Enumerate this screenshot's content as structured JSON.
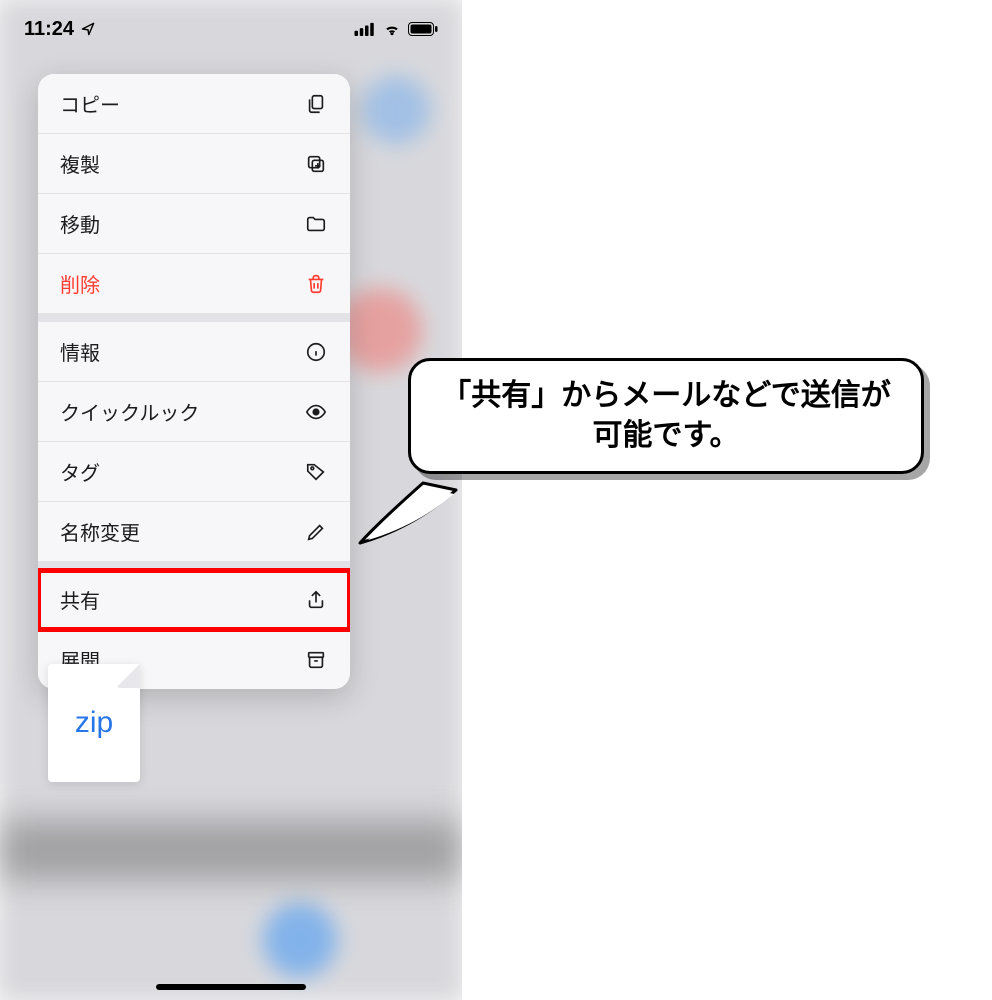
{
  "status_bar": {
    "time": "11:24"
  },
  "context_menu": {
    "sections": [
      {
        "items": [
          {
            "label": "コピー",
            "icon": "copy-icon",
            "destructive": false,
            "highlighted": false
          },
          {
            "label": "複製",
            "icon": "duplicate-icon",
            "destructive": false,
            "highlighted": false
          },
          {
            "label": "移動",
            "icon": "folder-icon",
            "destructive": false,
            "highlighted": false
          },
          {
            "label": "削除",
            "icon": "trash-icon",
            "destructive": true,
            "highlighted": false
          }
        ]
      },
      {
        "items": [
          {
            "label": "情報",
            "icon": "info-icon",
            "destructive": false,
            "highlighted": false
          },
          {
            "label": "クイックルック",
            "icon": "eye-icon",
            "destructive": false,
            "highlighted": false
          },
          {
            "label": "タグ",
            "icon": "tag-icon",
            "destructive": false,
            "highlighted": false
          },
          {
            "label": "名称変更",
            "icon": "rename-icon",
            "destructive": false,
            "highlighted": false
          }
        ]
      },
      {
        "items": [
          {
            "label": "共有",
            "icon": "share-icon",
            "destructive": false,
            "highlighted": true
          },
          {
            "label": "展開",
            "icon": "archive-icon",
            "destructive": false,
            "highlighted": false
          }
        ]
      }
    ]
  },
  "file": {
    "label": "zip"
  },
  "callout": {
    "text": "「共有」からメールなどで送信が可能です。"
  },
  "colors": {
    "destructive": "#ff3b30",
    "accent": "#2676e8",
    "highlight": "#ff0000"
  }
}
